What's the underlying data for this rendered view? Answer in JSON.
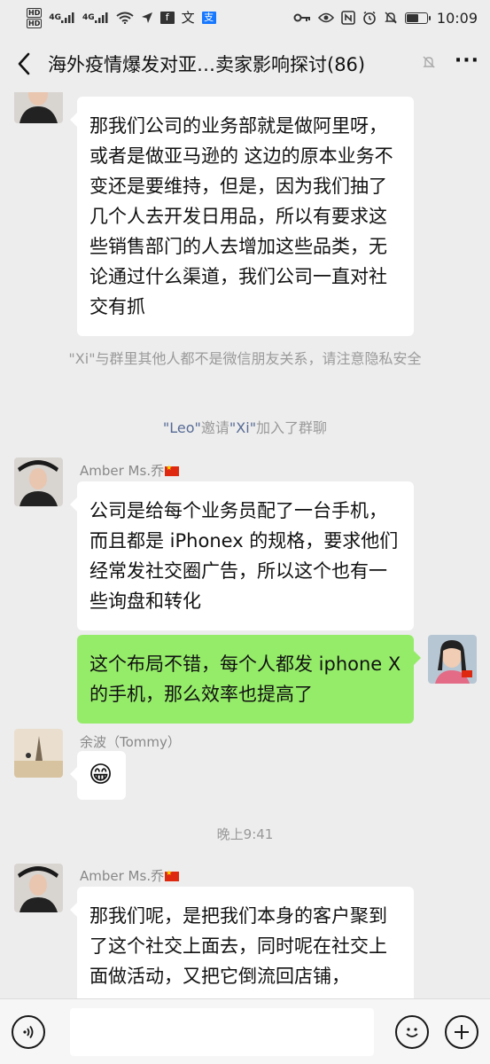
{
  "status_bar": {
    "time": "10:09",
    "battery_level": 0.55,
    "left_badges": [
      "HD",
      "HD"
    ],
    "network_labels": [
      "4G",
      "4G"
    ],
    "left_icons": [
      "signal-icon",
      "signal-icon",
      "wifi-icon",
      "location-icon",
      "facebook-icon",
      "translate-icon",
      "alipay-icon"
    ],
    "right_icons": [
      "key-icon",
      "eye-icon",
      "nfc-icon",
      "alarm-icon",
      "mute-bell-icon",
      "battery-icon"
    ]
  },
  "header": {
    "back_icon": "chevron-left-icon",
    "title": "海外疫情爆发对亚…卖家影响探讨(86)",
    "mute_icon": "muted-bell-icon",
    "more_icon": "more-dots-icon"
  },
  "messages": [
    {
      "type": "received",
      "text": "那我们公司的业务部就是做阿里呀，或者是做亚马逊的 这边的原本业务不变还是要维持，但是，因为我们抽了几个人去开发日用品，所以有要求这些销售部门的人去增加这些品类，无论通过什么渠道，我们公司一直对社交有抓"
    },
    {
      "type": "system",
      "name": "\"Xi\"",
      "text": "与群里其他人都不是微信朋友关系，请注意隐私安全"
    },
    {
      "type": "system_invite",
      "inviter": "\"Leo\"",
      "mid": "邀请",
      "invitee": "\"Xi\"",
      "suffix": "加入了群聊"
    },
    {
      "type": "received",
      "sender": "Amber Ms.乔",
      "text": "公司是给每个业务员配了一台手机，而且都是 iPhonex 的规格，要求他们经常发社交圈广告，所以这个也有一些询盘和转化"
    },
    {
      "type": "sent",
      "text": "这个布局不错，每个人都发 iphone X 的手机，那么效率也提高了"
    },
    {
      "type": "received",
      "sender": "余波（Tommy）",
      "text": "😁"
    },
    {
      "type": "time",
      "text": "晚上9:41"
    },
    {
      "type": "received",
      "sender": "Amber Ms.乔",
      "text": "那我们呢，是把我们本身的客户聚到了这个社交上面去，同时呢在社交上面做活动，又把它倒流回店铺，"
    }
  ],
  "input_bar": {
    "voice_icon": "voice-icon",
    "emoji_icon": "emoji-icon",
    "plus_icon": "plus-icon",
    "input_value": ""
  },
  "colors": {
    "sent_bubble": "#95ec69",
    "received_bubble": "#ffffff",
    "background": "#ededed",
    "link_name": "#576b95"
  }
}
